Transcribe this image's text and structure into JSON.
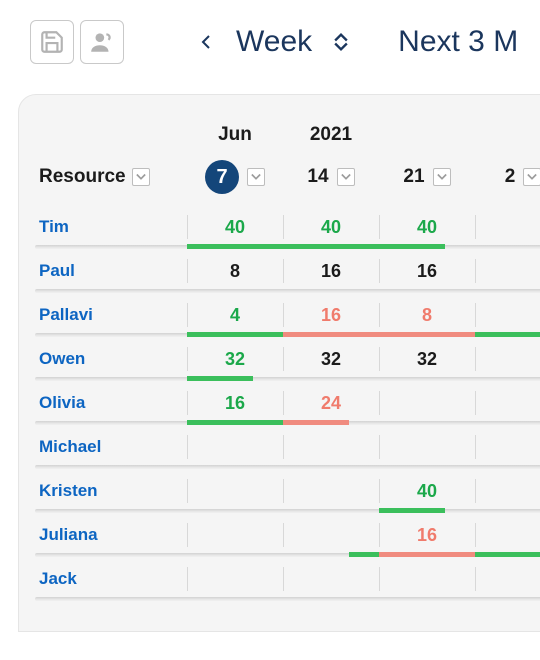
{
  "toolbar": {
    "save_icon": "save-icon",
    "assign_icon": "assign-user-icon",
    "prev_icon": "chevron-left-icon",
    "period_label": "Week",
    "range_label": "Next 3 M"
  },
  "header": {
    "resource_label": "Resource",
    "month": "Jun",
    "year": "2021",
    "dates": [
      {
        "day": "7",
        "current": true
      },
      {
        "day": "14",
        "current": false
      },
      {
        "day": "21",
        "current": false
      },
      {
        "day": "2",
        "current": false
      }
    ]
  },
  "rows": [
    {
      "name": "Tim",
      "cells": [
        {
          "value": "40",
          "color": "green",
          "bar": "green"
        },
        {
          "value": "40",
          "color": "green",
          "bar": "green"
        },
        {
          "value": "40",
          "color": "green",
          "bar": "green",
          "bar_mode": "short"
        },
        {
          "value": "",
          "color": "",
          "bar": ""
        }
      ]
    },
    {
      "name": "Paul",
      "cells": [
        {
          "value": "8",
          "color": "black",
          "bar": ""
        },
        {
          "value": "16",
          "color": "black",
          "bar": ""
        },
        {
          "value": "16",
          "color": "black",
          "bar": ""
        },
        {
          "value": "",
          "color": "",
          "bar": ""
        }
      ]
    },
    {
      "name": "Pallavi",
      "cells": [
        {
          "value": "4",
          "color": "green",
          "bar": "green"
        },
        {
          "value": "16",
          "color": "red",
          "bar": "red"
        },
        {
          "value": "8",
          "color": "red",
          "bar": "red"
        },
        {
          "value": "",
          "color": "",
          "bar": "green"
        }
      ]
    },
    {
      "name": "Owen",
      "cells": [
        {
          "value": "32",
          "color": "green",
          "bar": "green",
          "bar_mode": "short"
        },
        {
          "value": "32",
          "color": "black",
          "bar": ""
        },
        {
          "value": "32",
          "color": "black",
          "bar": ""
        },
        {
          "value": "",
          "color": "",
          "bar": ""
        }
      ]
    },
    {
      "name": "Olivia",
      "cells": [
        {
          "value": "16",
          "color": "green",
          "bar": "green"
        },
        {
          "value": "24",
          "color": "red",
          "bar": "red",
          "bar_mode": "short"
        },
        {
          "value": "",
          "color": "",
          "bar": ""
        },
        {
          "value": "",
          "color": "",
          "bar": ""
        }
      ]
    },
    {
      "name": "Michael",
      "cells": [
        {
          "value": "",
          "color": "",
          "bar": ""
        },
        {
          "value": "",
          "color": "",
          "bar": ""
        },
        {
          "value": "",
          "color": "",
          "bar": ""
        },
        {
          "value": "",
          "color": "",
          "bar": ""
        }
      ]
    },
    {
      "name": "Kristen",
      "cells": [
        {
          "value": "",
          "color": "",
          "bar": ""
        },
        {
          "value": "",
          "color": "",
          "bar": ""
        },
        {
          "value": "40",
          "color": "green",
          "bar": "green",
          "bar_mode": "short"
        },
        {
          "value": "",
          "color": "",
          "bar": ""
        }
      ]
    },
    {
      "name": "Juliana",
      "cells": [
        {
          "value": "",
          "color": "",
          "bar": ""
        },
        {
          "value": "",
          "color": "",
          "bar": "green",
          "bar_mode": "right-only"
        },
        {
          "value": "16",
          "color": "red",
          "bar": "red"
        },
        {
          "value": "",
          "color": "",
          "bar": "green"
        }
      ]
    },
    {
      "name": "Jack",
      "cells": [
        {
          "value": "",
          "color": "",
          "bar": ""
        },
        {
          "value": "",
          "color": "",
          "bar": ""
        },
        {
          "value": "",
          "color": "",
          "bar": ""
        },
        {
          "value": "",
          "color": "",
          "bar": ""
        }
      ]
    }
  ]
}
